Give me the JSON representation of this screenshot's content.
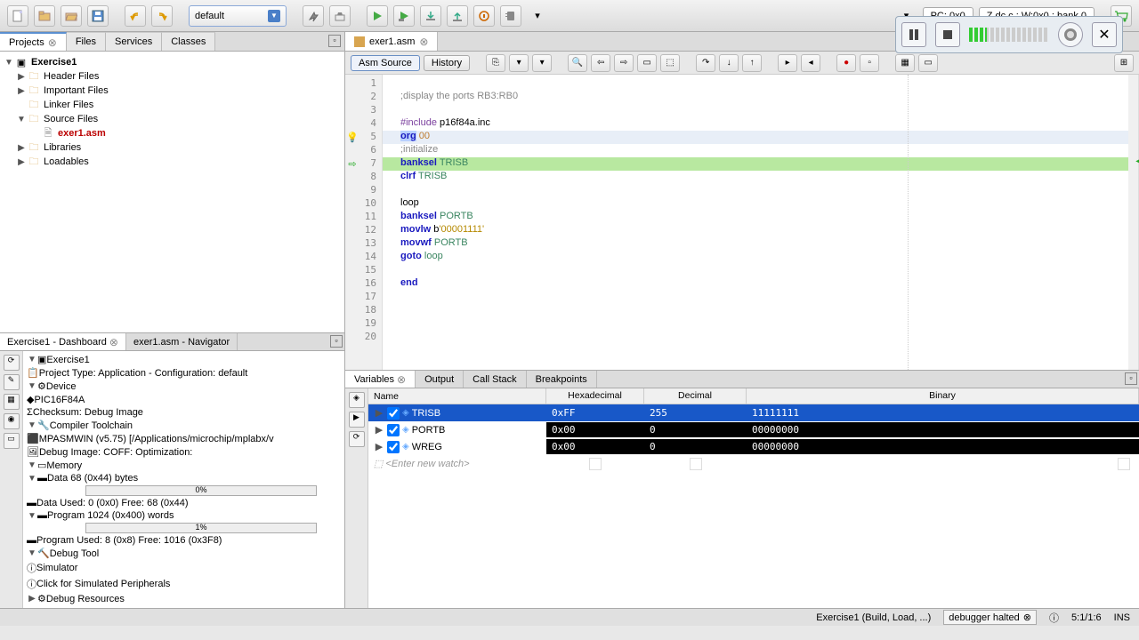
{
  "toolbar": {
    "config_selected": "default",
    "pc_label": "PC: 0x0",
    "status_flags": "Z dc c : W:0x0 : bank 0"
  },
  "left_tabs": {
    "projects": "Projects",
    "files": "Files",
    "services": "Services",
    "classes": "Classes"
  },
  "project_tree": {
    "root": "Exercise1",
    "header_files": "Header Files",
    "important_files": "Important Files",
    "linker_files": "Linker Files",
    "source_files": "Source Files",
    "exer1_asm": "exer1.asm",
    "libraries": "Libraries",
    "loadables": "Loadables"
  },
  "dashboard": {
    "tab1": "Exercise1 - Dashboard",
    "tab2": "exer1.asm - Navigator",
    "root": "Exercise1",
    "project_type": "Project Type: Application - Configuration: default",
    "device": "Device",
    "device_name": "PIC16F84A",
    "checksum": "Checksum: Debug Image",
    "compiler": "Compiler Toolchain",
    "mpasm": "MPASMWIN (v5.75) [/Applications/microchip/mplabx/v",
    "debug_image": "Debug Image: COFF: Optimization:",
    "memory": "Memory",
    "data_bytes": "Data 68 (0x44) bytes",
    "data_pct": "0%",
    "data_used": "Data Used: 0 (0x0) Free: 68 (0x44)",
    "program_words": "Program 1024 (0x400) words",
    "program_pct": "1%",
    "program_used": "Program Used: 8 (0x8) Free: 1016 (0x3F8)",
    "debug_tool": "Debug Tool",
    "simulator": "Simulator",
    "click_peripherals": "Click for Simulated Peripherals",
    "debug_resources": "Debug Resources"
  },
  "editor": {
    "tab_name": "exer1.asm",
    "mode_asm": "Asm Source",
    "mode_history": "History",
    "code": {
      "l1": ";display the ports RB3:RB0",
      "l4_1": "#include",
      "l4_2": " p16f84a.inc",
      "l5_1": "org",
      "l5_2": " 00",
      "l6": ";initialize",
      "l7_1": "banksel",
      "l7_2": " TRISB",
      "l8_1": "clrf",
      "l8_2": " TRISB",
      "l10": "loop",
      "l11_1": "banksel",
      "l11_2": " PORTB",
      "l12_1": "movlw",
      "l12_2": " b",
      "l12_3": "'00001111'",
      "l13_1": "movwf",
      "l13_2": " PORTB",
      "l14_1": "goto",
      "l14_2": " loop",
      "l16": "end"
    }
  },
  "variables": {
    "tab_variables": "Variables",
    "tab_output": "Output",
    "tab_callstack": "Call Stack",
    "tab_breakpoints": "Breakpoints",
    "col_name": "Name",
    "col_hex": "Hexadecimal",
    "col_dec": "Decimal",
    "col_bin": "Binary",
    "rows": [
      {
        "name": "TRISB",
        "hex": "0xFF",
        "dec": "255",
        "bin": "11111111"
      },
      {
        "name": "PORTB",
        "hex": "0x00",
        "dec": "0",
        "bin": "00000000"
      },
      {
        "name": "WREG",
        "hex": "0x00",
        "dec": "0",
        "bin": "00000000"
      }
    ],
    "new_watch": "<Enter new watch>"
  },
  "statusbar": {
    "build": "Exercise1 (Build, Load, ...)",
    "debug_state": "debugger halted",
    "cursor": "5:1/1:6",
    "mode": "INS"
  }
}
